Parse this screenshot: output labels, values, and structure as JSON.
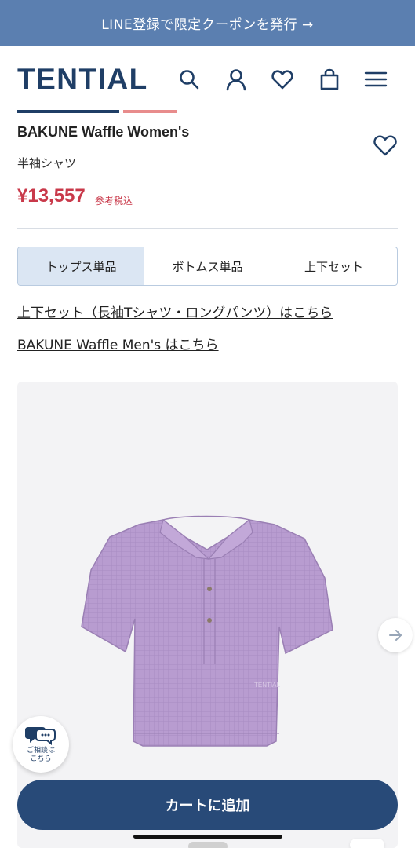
{
  "promo": {
    "text": "LINE登録で限定クーポンを発行 →"
  },
  "header": {
    "logo": "TENTIAL",
    "icons": [
      "search-icon",
      "account-icon",
      "heart-icon",
      "bag-icon",
      "menu-icon"
    ]
  },
  "product": {
    "title": "BAKUNE Waffle Women's",
    "subtitle": "半袖シャツ",
    "price": "¥13,557",
    "price_note": "参考税込",
    "image_logo": "TENTIAL"
  },
  "tabs": [
    {
      "label": "トップス単品",
      "active": true
    },
    {
      "label": "ボトムス単品",
      "active": false
    },
    {
      "label": "上下セット",
      "active": false
    }
  ],
  "links": {
    "set_long": "上下セット（長袖Tシャツ・ロングパンツ）はこちら",
    "mens": "BAKUNE Waffle Men's はこちら"
  },
  "consult": {
    "label": "ご相談は\nこちら"
  },
  "cart": {
    "label": "カートに追加"
  },
  "colors": {
    "brand": "#1f3e66",
    "promo_bg": "#5b7fb0",
    "price": "#c9394a",
    "cart_bg": "#284a78",
    "shirt": "#b89cd0"
  }
}
